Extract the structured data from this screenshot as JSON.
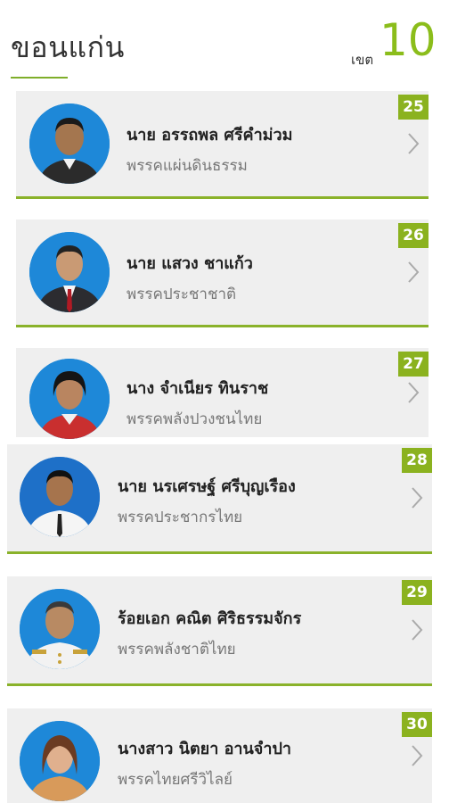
{
  "header": {
    "province": "ขอนแก่น",
    "district_label": "เขต",
    "district_number": "10"
  },
  "colors": {
    "accent": "#8bb21f",
    "card_bg": "#efefef",
    "avatar_bg": "#1e88d8"
  },
  "candidates": [
    {
      "number": "25",
      "name": "นาย อรรถพล ศรีคำม่วม",
      "party": "พรรคแผ่นดินธรรม",
      "shirt": "#2b2b2b",
      "skin": "#a4764f"
    },
    {
      "number": "26",
      "name": "นาย แสวง ชาแก้ว",
      "party": "พรรคประชาชาติ",
      "shirt": "#2c2c30",
      "skin": "#c99a74"
    },
    {
      "number": "27",
      "name": "นาง จำเนียร ทินราช",
      "party": "พรรคพลังปวงชนไทย",
      "shirt": "#c92f2f",
      "skin": "#b98560"
    },
    {
      "number": "28",
      "name": "นาย นรเศรษฐ์ ศรีบุญเรือง",
      "party": "พรรคประชากรไทย",
      "shirt": "#f5f5f5",
      "skin": "#a6744d"
    },
    {
      "number": "29",
      "name": "ร้อยเอก คณิต ศิริธรรมจักร",
      "party": "พรรคพลังชาติไทย",
      "shirt": "#f2f2f2",
      "skin": "#b88a63"
    },
    {
      "number": "30",
      "name": "นางสาว นิตยา อานจำปา",
      "party": "พรรคไทยศรีวิไลย์",
      "shirt": "#d89a5a",
      "skin": "#e0b08e"
    }
  ]
}
